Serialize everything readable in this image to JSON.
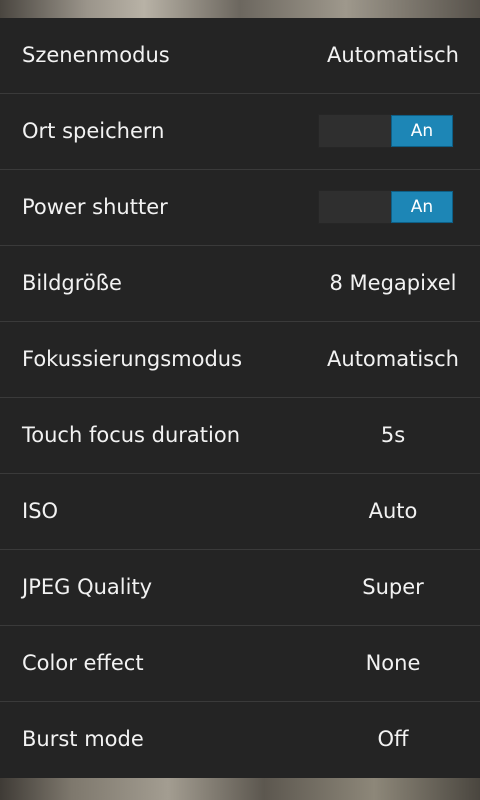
{
  "settings": [
    {
      "label": "Szenenmodus",
      "value": "Automatisch",
      "type": "value"
    },
    {
      "label": "Ort speichern",
      "value": "An",
      "type": "toggle",
      "on": true
    },
    {
      "label": "Power shutter",
      "value": "An",
      "type": "toggle",
      "on": true
    },
    {
      "label": "Bildgröße",
      "value": "8 Megapixel",
      "type": "value"
    },
    {
      "label": "Fokussierungsmodus",
      "value": "Automatisch",
      "type": "value"
    },
    {
      "label": "Touch focus duration",
      "value": "5s",
      "type": "value"
    },
    {
      "label": "ISO",
      "value": "Auto",
      "type": "value"
    },
    {
      "label": "JPEG Quality",
      "value": "Super",
      "type": "value"
    },
    {
      "label": "Color effect",
      "value": "None",
      "type": "value"
    },
    {
      "label": "Burst mode",
      "value": "Off",
      "type": "value"
    }
  ],
  "colors": {
    "panel_bg": "#242424",
    "divider": "#3a3a3a",
    "text": "#f2f2f2",
    "toggle_on": "#1d86b6"
  }
}
